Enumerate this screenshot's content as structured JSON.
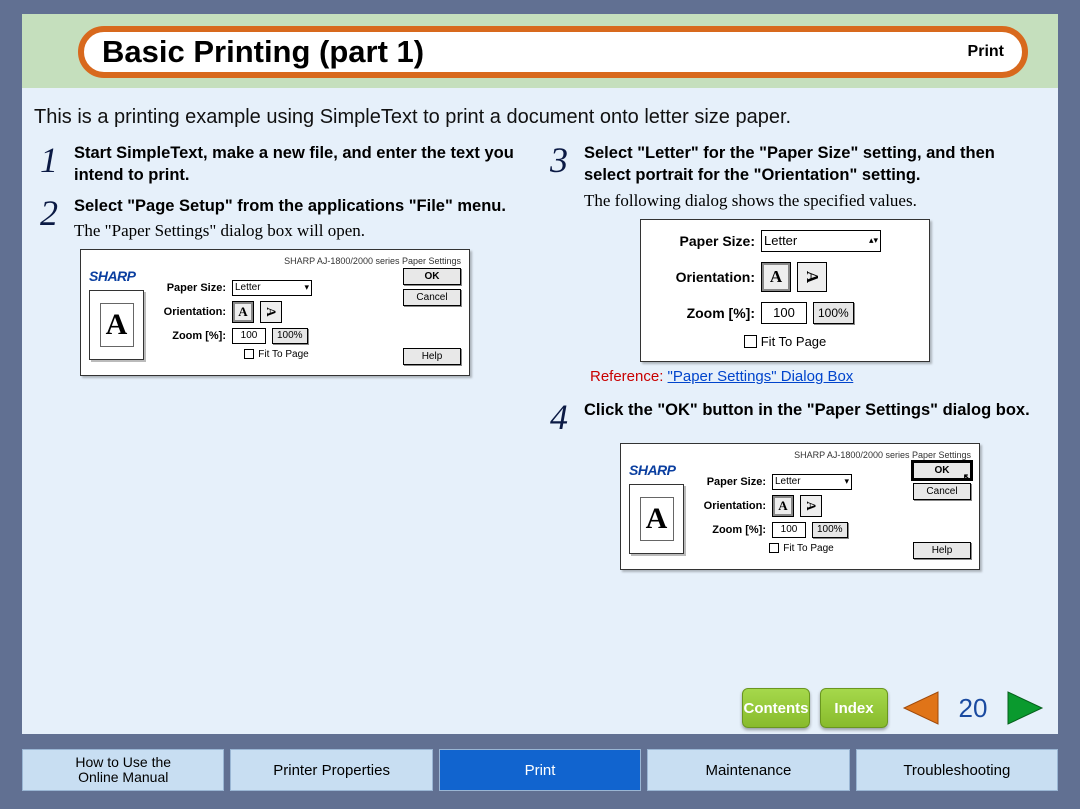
{
  "header": {
    "title": "Basic Printing (part 1)",
    "section": "Print"
  },
  "intro": "This is a printing example using SimpleText to print a document onto letter size paper.",
  "steps": {
    "s1": {
      "num": "1",
      "title": "Start SimpleText, make a new file, and enter the text you intend to print."
    },
    "s2": {
      "num": "2",
      "title": "Select \"Page Setup\" from the applications \"File\" menu.",
      "note": "The \"Paper Settings\" dialog box will open."
    },
    "s3": {
      "num": "3",
      "title": "Select \"Letter\" for the \"Paper Size\" setting, and then select portrait for the \"Orientation\" setting.",
      "note": "The following dialog shows the specified values."
    },
    "s4": {
      "num": "4",
      "title": "Click the \"OK\" button in the \"Paper Settings\" dialog box."
    }
  },
  "reference": {
    "label": "Reference:",
    "link": "\"Paper Settings\" Dialog Box"
  },
  "dialog": {
    "header": "SHARP AJ-1800/2000 series Paper Settings",
    "brand": "SHARP",
    "preview_letter": "A",
    "labels": {
      "paper_size": "Paper Size:",
      "orientation": "Orientation:",
      "zoom": "Zoom [%]:",
      "fit": "Fit To Page"
    },
    "paper_size_value": "Letter",
    "zoom_value": "100",
    "zoom_reset": "100%",
    "buttons": {
      "ok": "OK",
      "cancel": "Cancel",
      "help": "Help"
    }
  },
  "nav": {
    "contents": "Contents",
    "index": "Index",
    "page": "20"
  },
  "tabs": {
    "howto_l1": "How to Use the",
    "howto_l2": "Online Manual",
    "printer_props": "Printer Properties",
    "print": "Print",
    "maintenance": "Maintenance",
    "troubleshooting": "Troubleshooting"
  }
}
